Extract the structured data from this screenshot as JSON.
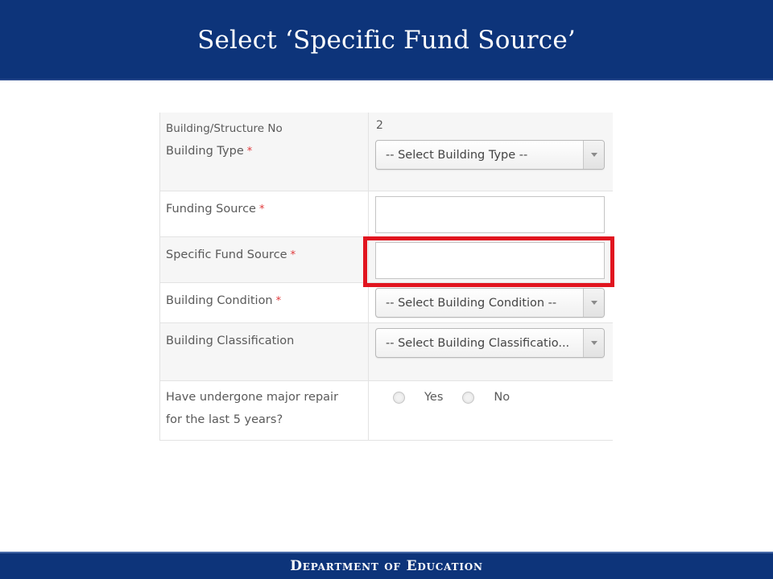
{
  "header": {
    "title": "Select ‘Specific Fund Source’"
  },
  "form": {
    "building_no": {
      "label": "Building/Structure No",
      "value": "2"
    },
    "building_type": {
      "label": "Building Type",
      "required": "*",
      "placeholder": "-- Select Building Type --"
    },
    "funding_source": {
      "label": "Funding Source",
      "required": "*",
      "value": ""
    },
    "specific_fund_source": {
      "label": "Specific Fund Source",
      "required": "*",
      "value": "",
      "highlighted": true
    },
    "building_condition": {
      "label": "Building Condition",
      "required": "*",
      "placeholder": "-- Select Building Condition --"
    },
    "building_classification": {
      "label": "Building Classification",
      "placeholder": "-- Select Building Classificatio..."
    },
    "major_repair": {
      "label_line1": "Have undergone major repair",
      "label_line2": "for the last 5 years?",
      "options": [
        "Yes",
        "No"
      ],
      "selected": null
    }
  },
  "colors": {
    "banner": "#0d347a",
    "highlight": "#e1151f",
    "required": "#e0393b"
  },
  "footer": {
    "text": "Department of Education"
  }
}
